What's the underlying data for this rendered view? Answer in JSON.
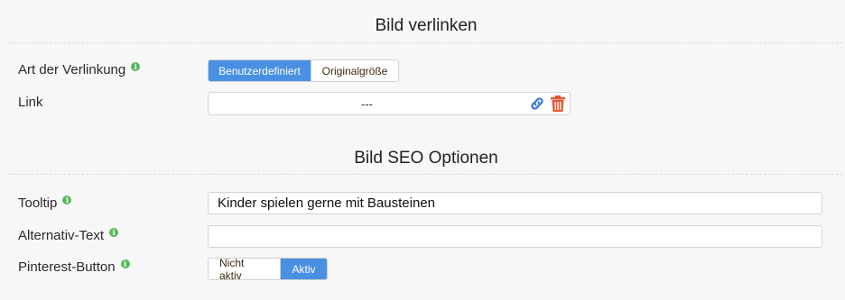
{
  "link_section": {
    "title": "Bild verlinken",
    "link_type": {
      "label": "Art der Verlinkung",
      "options": [
        "Benutzerdefiniert",
        "Originalgröße"
      ],
      "selected": "Benutzerdefiniert"
    },
    "link": {
      "label": "Link",
      "value": "---"
    }
  },
  "seo_section": {
    "title": "Bild SEO Optionen",
    "tooltip": {
      "label": "Tooltip",
      "value": "Kinder spielen gerne mit Bausteinen"
    },
    "alt_text": {
      "label": "Alternativ-Text",
      "value": ""
    },
    "pinterest": {
      "label": "Pinterest-Button",
      "options": [
        "Nicht aktiv",
        "Aktiv"
      ],
      "selected": "Aktiv"
    }
  },
  "info_icon_glyph": "i",
  "colors": {
    "active": "#4a90e2",
    "info": "#5cb85c",
    "link_icon": "#3a7bd5",
    "delete_icon": "#e8552d"
  }
}
